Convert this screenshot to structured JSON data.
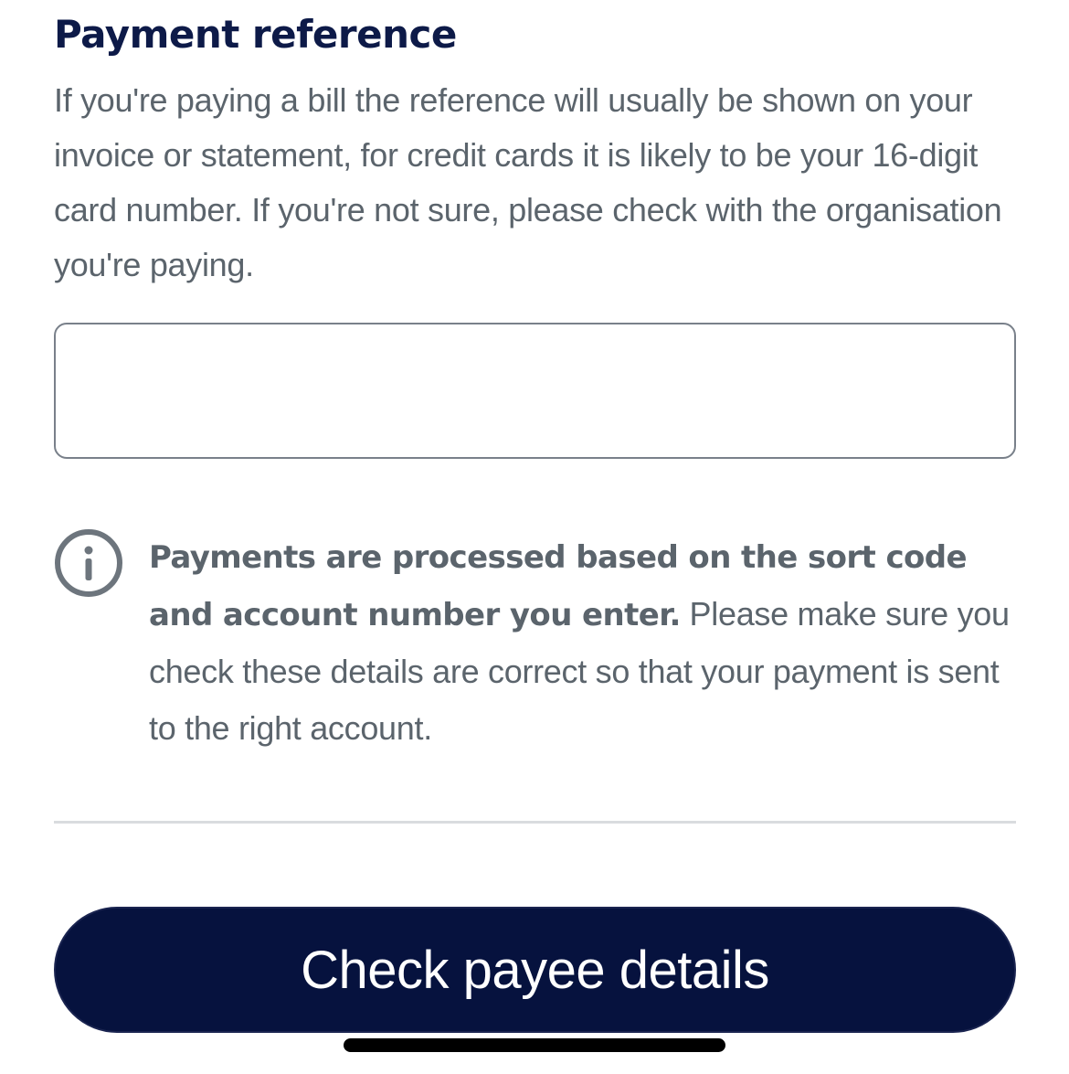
{
  "payment_reference": {
    "title": "Payment reference",
    "helper_text": "If you're paying a bill the reference will usually be shown on your invoice or statement, for credit cards it is likely to be your 16-digit card number. If you're not sure, please check with the organisation you're paying.",
    "input_value": ""
  },
  "notice": {
    "icon": "info-icon",
    "bold_text": "Payments are processed based on the sort code and account number you enter.",
    "text": " Please make sure you check these details are correct so that your payment is sent to the right account."
  },
  "actions": {
    "check_payee_label": "Check payee details"
  },
  "colors": {
    "brand_navy": "#06123e",
    "title_navy": "#0d1a48",
    "body_grey": "#5b646c",
    "border_grey": "#79808a",
    "divider_grey": "#d9dcdf"
  }
}
